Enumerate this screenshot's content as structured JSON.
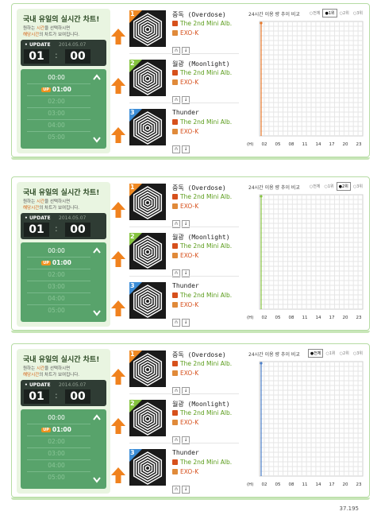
{
  "panels": [
    {
      "title": "국내 유일의 실시간 차트!",
      "subtitle_pre": "원하는 ",
      "subtitle_hl1": "시간",
      "subtitle_mid": "을 선택하시면",
      "subtitle_hl2": "해당시간",
      "subtitle_post": "의 차트가 보여집니다.",
      "update_label": "UPDATE",
      "date": "2014.05.07",
      "hour": "01",
      "minute": "00",
      "times": [
        "00:00",
        "01:00",
        "02:00",
        "03:00",
        "04:00",
        "05:00"
      ],
      "current_badge": "UP",
      "chart_title": "24시간 이용 량 추이 비교",
      "chart_options": [
        "전체",
        "1위",
        "2위",
        "3위"
      ],
      "chart_selected": 1,
      "songs": [
        {
          "rank": "1",
          "title": "중독 (Overdose)",
          "album": "The 2nd Mini Alb.",
          "artist": "EXO-K"
        },
        {
          "rank": "2",
          "title": "월광 (Moonlight)",
          "album": "The 2nd Mini Alb.",
          "artist": "EXO-K"
        },
        {
          "rank": "3",
          "title": "Thunder",
          "album": "The 2nd Mini Alb.",
          "artist": "EXO-K"
        }
      ]
    },
    {
      "title": "국내 유일의 실시간 차트!",
      "subtitle_pre": "원하는 ",
      "subtitle_hl1": "시간",
      "subtitle_mid": "을 선택하시면",
      "subtitle_hl2": "해당시간",
      "subtitle_post": "의 차트가 보여집니다.",
      "update_label": "UPDATE",
      "date": "2014.05.07",
      "hour": "01",
      "minute": "00",
      "times": [
        "00:00",
        "01:00",
        "02:00",
        "03:00",
        "04:00",
        "05:00"
      ],
      "current_badge": "UP",
      "chart_title": "24시간 이용 량 추이 비교",
      "chart_options": [
        "전체",
        "1위",
        "2위",
        "3위"
      ],
      "chart_selected": 2,
      "songs": [
        {
          "rank": "1",
          "title": "중독 (Overdose)",
          "album": "The 2nd Mini Alb.",
          "artist": "EXO-K"
        },
        {
          "rank": "2",
          "title": "월광 (Moonlight)",
          "album": "The 2nd Mini Alb.",
          "artist": "EXO-K"
        },
        {
          "rank": "3",
          "title": "Thunder",
          "album": "The 2nd Mini Alb.",
          "artist": "EXO-K"
        }
      ]
    },
    {
      "title": "국내 유일의 실시간 차트!",
      "subtitle_pre": "원하는 ",
      "subtitle_hl1": "시간",
      "subtitle_mid": "을 선택하시면",
      "subtitle_hl2": "해당시간",
      "subtitle_post": "의 차트가 보여집니다.",
      "update_label": "UPDATE",
      "date": "2014.05.07",
      "hour": "01",
      "minute": "00",
      "times": [
        "00:00",
        "01:00",
        "02:00",
        "03:00",
        "04:00",
        "05:00"
      ],
      "current_badge": "UP",
      "chart_title": "24시간 이용 량 추이 비교",
      "chart_options": [
        "전체",
        "1위",
        "2위",
        "3위"
      ],
      "chart_selected": 0,
      "songs": [
        {
          "rank": "1",
          "title": "중독 (Overdose)",
          "album": "The 2nd Mini Alb.",
          "artist": "EXO-K"
        },
        {
          "rank": "2",
          "title": "월광 (Moonlight)",
          "album": "The 2nd Mini Alb.",
          "artist": "EXO-K"
        },
        {
          "rank": "3",
          "title": "Thunder",
          "album": "The 2nd Mini Alb.",
          "artist": "EXO-K"
        }
      ]
    }
  ],
  "chart_data": [
    {
      "type": "line",
      "xlabel": "(H)",
      "x": [
        "02",
        "05",
        "08",
        "11",
        "14",
        "17",
        "20",
        "23"
      ],
      "series": [
        {
          "color": "#e8782a",
          "values": [
            0
          ]
        }
      ]
    },
    {
      "type": "line",
      "xlabel": "(H)",
      "x": [
        "02",
        "05",
        "08",
        "11",
        "14",
        "17",
        "20",
        "23"
      ],
      "series": [
        {
          "color": "#86c440",
          "values": [
            0
          ]
        }
      ]
    },
    {
      "type": "line",
      "xlabel": "(H)",
      "x": [
        "02",
        "05",
        "08",
        "11",
        "14",
        "17",
        "20",
        "23"
      ],
      "series": [
        {
          "color": "#4a7ec8",
          "values": [
            0
          ]
        }
      ]
    }
  ],
  "colors": {
    "panel_border": "#b6dca4",
    "time_list": "#58a36b",
    "arrow": "#f0821e",
    "rank_1": "#f08a24",
    "rank_2": "#86c440",
    "rank_3": "#3b8cd6"
  },
  "footer": {
    "page": "37.195"
  }
}
